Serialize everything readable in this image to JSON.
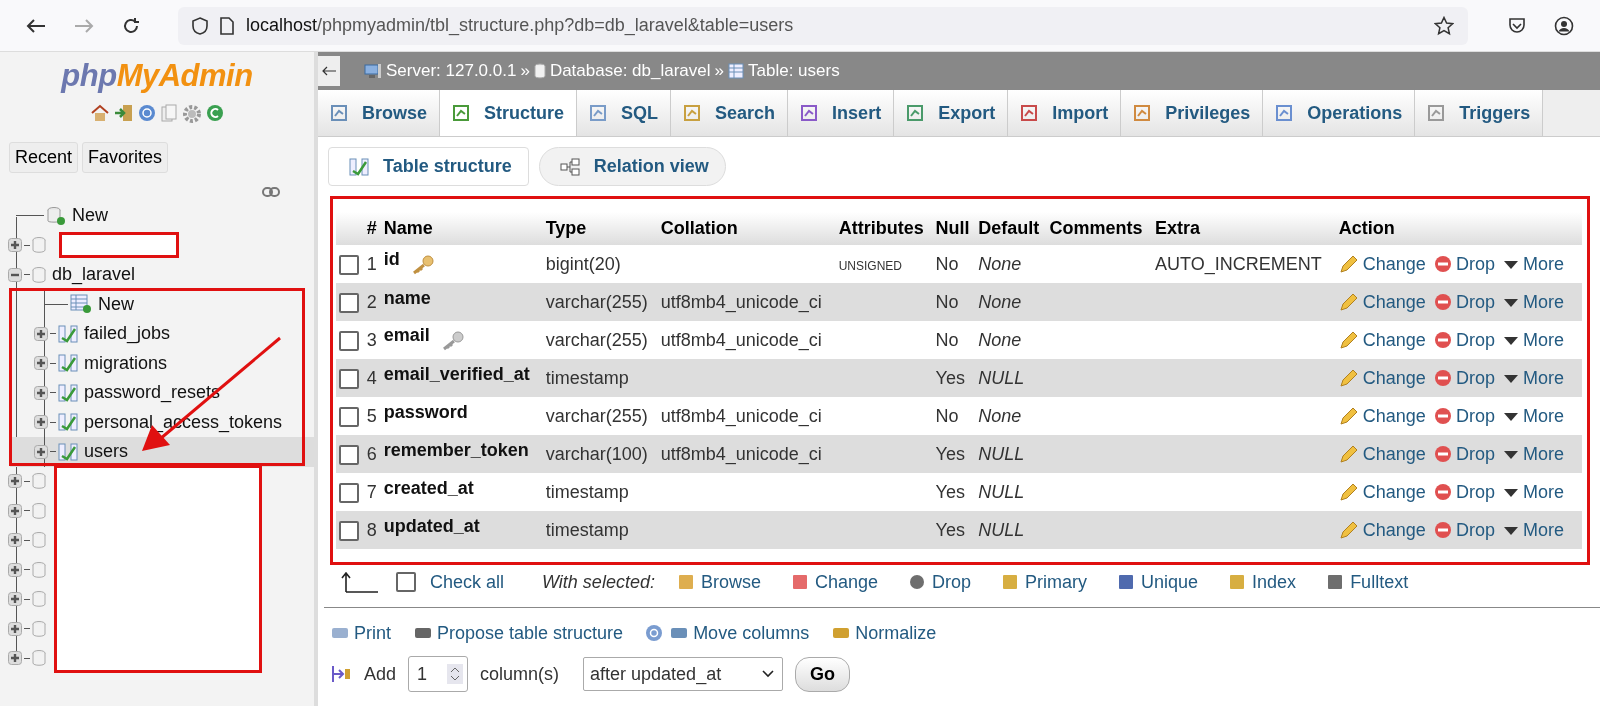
{
  "browser": {
    "url_host": "localhost",
    "url_path": "/phpmyadmin/tbl_structure.php?db=db_laravel&table=users"
  },
  "sidebar": {
    "logo_php": "php",
    "logo_myadmin": "MyAdmin",
    "buttons": [
      "Recent",
      "Favorites"
    ],
    "tree": [
      {
        "kind": "new",
        "label": "New"
      },
      {
        "kind": "redacted",
        "expanded": false
      },
      {
        "kind": "database",
        "label": "db_laravel",
        "expanded": true,
        "children": [
          {
            "kind": "new",
            "label": "New",
            "selected": false
          },
          {
            "kind": "table",
            "label": "failed_jobs",
            "selected": false
          },
          {
            "kind": "table",
            "label": "migrations",
            "selected": false
          },
          {
            "kind": "table",
            "label": "password_resets",
            "selected": false
          },
          {
            "kind": "table",
            "label": "personal_access_tokens",
            "selected": false
          },
          {
            "kind": "table",
            "label": "users",
            "selected": true
          }
        ]
      },
      {
        "kind": "redacted",
        "expanded": false
      },
      {
        "kind": "redacted",
        "expanded": false
      },
      {
        "kind": "redacted",
        "expanded": false
      },
      {
        "kind": "redacted",
        "expanded": false
      },
      {
        "kind": "redacted",
        "expanded": false
      },
      {
        "kind": "redacted",
        "expanded": false
      },
      {
        "kind": "redacted",
        "expanded": false
      }
    ]
  },
  "breadcrumb": [
    {
      "kind": "server",
      "label": "Server: 127.0.0.1"
    },
    {
      "kind": "separator",
      "label": "»"
    },
    {
      "kind": "database",
      "label": "Database: db_laravel"
    },
    {
      "kind": "separator",
      "label": "»"
    },
    {
      "kind": "table",
      "label": "Table: users"
    }
  ],
  "tabs": [
    {
      "label": "Browse",
      "selected": false
    },
    {
      "label": "Structure",
      "selected": true
    },
    {
      "label": "SQL",
      "selected": false
    },
    {
      "label": "Search",
      "selected": false
    },
    {
      "label": "Insert",
      "selected": false
    },
    {
      "label": "Export",
      "selected": false
    },
    {
      "label": "Import",
      "selected": false
    },
    {
      "label": "Privileges",
      "selected": false
    },
    {
      "label": "Operations",
      "selected": false
    },
    {
      "label": "Triggers",
      "selected": false
    }
  ],
  "subtabs": [
    {
      "label": "Table structure",
      "selected": true
    },
    {
      "label": "Relation view",
      "selected": false
    }
  ],
  "table": {
    "columns": [
      "#",
      "Name",
      "Type",
      "Collation",
      "Attributes",
      "Null",
      "Default",
      "Comments",
      "Extra",
      "Action"
    ],
    "rows": [
      {
        "checked": false,
        "num": "1",
        "name": "id",
        "kind": "primary_key",
        "type": "bigint(20)",
        "collation": "",
        "attributes": "UNSIGNED",
        "null": "No",
        "default": "None",
        "extra": "AUTO_INCREMENT",
        "actions": [
          "Change",
          "Drop",
          "More"
        ]
      },
      {
        "checked": false,
        "num": "2",
        "name": "name",
        "kind": "plain",
        "type": "varchar(255)",
        "collation": "utf8mb4_unicode_ci",
        "attributes": "",
        "null": "No",
        "default": "None",
        "extra": "",
        "actions": [
          "Change",
          "Drop",
          "More"
        ]
      },
      {
        "checked": false,
        "num": "3",
        "name": "email",
        "kind": "unique_key",
        "type": "varchar(255)",
        "collation": "utf8mb4_unicode_ci",
        "attributes": "",
        "null": "No",
        "default": "None",
        "extra": "",
        "actions": [
          "Change",
          "Drop",
          "More"
        ]
      },
      {
        "checked": false,
        "num": "4",
        "name": "email_verified_at",
        "kind": "plain",
        "type": "timestamp",
        "collation": "",
        "attributes": "",
        "null": "Yes",
        "default": "NULL",
        "extra": "",
        "actions": [
          "Change",
          "Drop",
          "More"
        ]
      },
      {
        "checked": false,
        "num": "5",
        "name": "password",
        "kind": "plain",
        "type": "varchar(255)",
        "collation": "utf8mb4_unicode_ci",
        "attributes": "",
        "null": "No",
        "default": "None",
        "extra": "",
        "actions": [
          "Change",
          "Drop",
          "More"
        ]
      },
      {
        "checked": false,
        "num": "6",
        "name": "remember_token",
        "kind": "plain",
        "type": "varchar(100)",
        "collation": "utf8mb4_unicode_ci",
        "attributes": "",
        "null": "Yes",
        "default": "NULL",
        "extra": "",
        "actions": [
          "Change",
          "Drop",
          "More"
        ]
      },
      {
        "checked": false,
        "num": "7",
        "name": "created_at",
        "kind": "plain",
        "type": "timestamp",
        "collation": "",
        "attributes": "",
        "null": "Yes",
        "default": "NULL",
        "extra": "",
        "actions": [
          "Change",
          "Drop",
          "More"
        ]
      },
      {
        "checked": false,
        "num": "8",
        "name": "updated_at",
        "kind": "plain",
        "type": "timestamp",
        "collation": "",
        "attributes": "",
        "null": "Yes",
        "default": "NULL",
        "extra": "",
        "actions": [
          "Change",
          "Drop",
          "More"
        ]
      }
    ]
  },
  "bulk": {
    "check_all": "Check all",
    "checked": false,
    "with_selected": "With selected:",
    "actions": [
      "Browse",
      "Change",
      "Drop",
      "Primary",
      "Unique",
      "Index",
      "Fulltext"
    ]
  },
  "tools": [
    "Print",
    "Propose table structure",
    "Move columns",
    "Normalize"
  ],
  "add_column": {
    "label": "Add",
    "value": "1",
    "unit": "column(s)",
    "position": "after updated_at",
    "go": "Go"
  }
}
